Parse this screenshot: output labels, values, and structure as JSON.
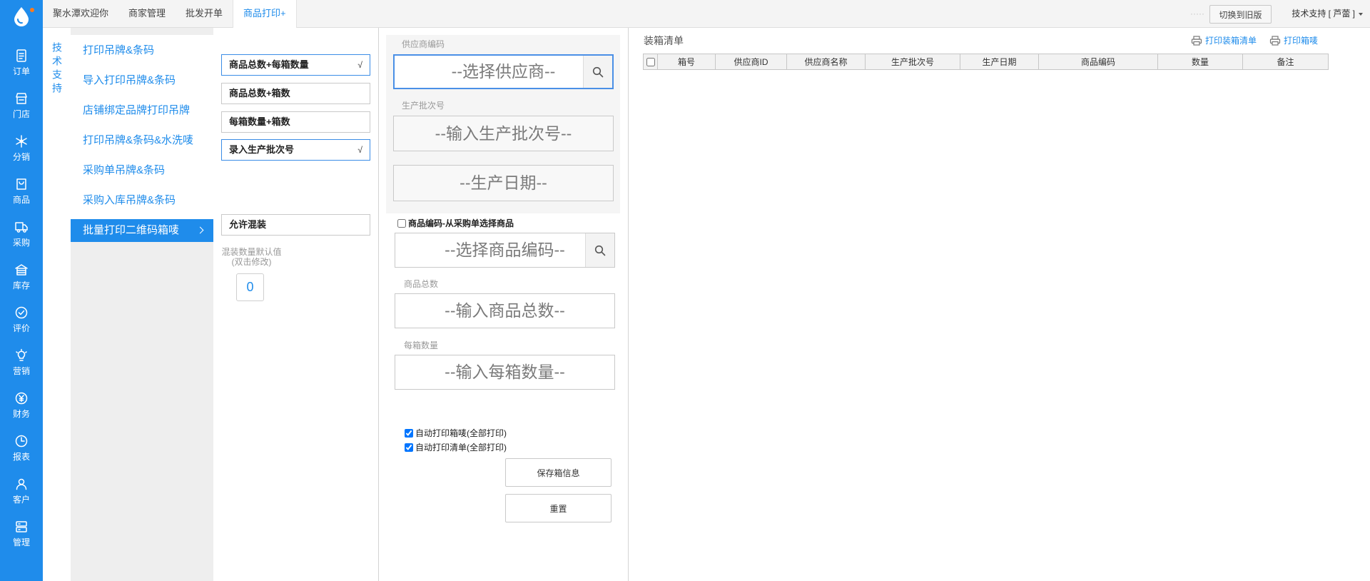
{
  "tabs": [
    {
      "label": "聚水潭欢迎你"
    },
    {
      "label": "商家管理"
    },
    {
      "label": "批发开单"
    },
    {
      "label": "商品打印+",
      "active": true
    }
  ],
  "header_right": {
    "dots": "·····",
    "switch_label": "切换到旧版",
    "user_label": "技术支持 [ 芦蕾 ]"
  },
  "sidebar": {
    "logo_icon": "water-drop-logo",
    "items": [
      {
        "label": "订单",
        "icon": "order-icon"
      },
      {
        "label": "门店",
        "icon": "store-icon"
      },
      {
        "label": "分销",
        "icon": "distribution-icon"
      },
      {
        "label": "商品",
        "icon": "product-icon"
      },
      {
        "label": "采购",
        "icon": "purchase-icon"
      },
      {
        "label": "库存",
        "icon": "inventory-icon"
      },
      {
        "label": "评价",
        "icon": "review-icon"
      },
      {
        "label": "营销",
        "icon": "marketing-icon"
      },
      {
        "label": "财务",
        "icon": "finance-icon"
      },
      {
        "label": "报表",
        "icon": "report-icon"
      },
      {
        "label": "客户",
        "icon": "customer-icon"
      },
      {
        "label": "管理",
        "icon": "management-icon"
      }
    ]
  },
  "side_tab": {
    "label": "技术支持"
  },
  "menu": {
    "items": [
      {
        "label": "打印吊牌&条码"
      },
      {
        "label": "导入打印吊牌&条码"
      },
      {
        "label": "店铺绑定品牌打印吊牌"
      },
      {
        "label": "打印吊牌&条码&水洗唛"
      },
      {
        "label": "采购单吊牌&条码"
      },
      {
        "label": "采购入库吊牌&条码"
      },
      {
        "label": "批量打印二维码箱唛",
        "active": true
      }
    ]
  },
  "options": {
    "items": [
      {
        "label": "商品总数+每箱数量",
        "mark": "√",
        "selected": true
      },
      {
        "label": "商品总数+箱数",
        "mark": "",
        "selected": false
      },
      {
        "label": "每箱数量+箱数",
        "mark": "",
        "selected": false
      },
      {
        "label": "录入生产批次号",
        "mark": "√",
        "selected": true
      }
    ],
    "mix_label": "允许混装",
    "mix_default_label": "混装数量默认值",
    "mix_default_hint": "(双击修改)",
    "mix_default_value": "0"
  },
  "form": {
    "supplier_label": "供应商编码",
    "supplier_placeholder": "--选择供应商--",
    "batch_label": "生产批次号",
    "batch_placeholder": "--输入生产批次号--",
    "date_placeholder": "--生产日期--",
    "product_code_checkbox": "商品编码-从采购单选择商品",
    "product_code_checked": false,
    "product_code_placeholder": "--选择商品编码--",
    "total_label": "商品总数",
    "total_placeholder": "--输入商品总数--",
    "per_box_label": "每箱数量",
    "per_box_placeholder": "--输入每箱数量--",
    "auto_print_label_text": "自动打印箱唛(全部打印)",
    "auto_print_label_checked": true,
    "auto_print_list_text": "自动打印清单(全部打印)",
    "auto_print_list_checked": true,
    "save_button": "保存箱信息",
    "reset_button": "重置"
  },
  "packing_list": {
    "title": "装箱清单",
    "print_list_label": "打印装箱清单",
    "print_label_label": "打印箱唛",
    "select_all_checked": false,
    "columns": [
      "箱号",
      "供应商ID",
      "供应商名称",
      "生产批次号",
      "生产日期",
      "商品编码",
      "数量",
      "备注"
    ]
  },
  "colors": {
    "primary": "#1f8ceb",
    "sidebar_bg": "#1f8ceb",
    "logo_dot": "#ff7a1a",
    "focus_border": "#4a8fe6"
  }
}
